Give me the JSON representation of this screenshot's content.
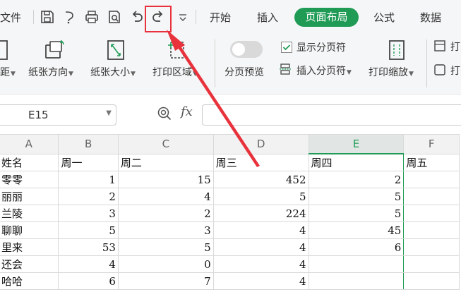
{
  "menubar": {
    "file": "文件",
    "tabs": [
      "开始",
      "插入",
      "页面布局",
      "公式",
      "数据"
    ],
    "active_tab": "页面布局",
    "quick_icons": [
      "save-icon",
      "format-painter-icon",
      "print-icon",
      "print-preview-icon",
      "undo-icon",
      "redo-icon",
      "more-dropdown-icon"
    ]
  },
  "ribbon": {
    "margins": "距",
    "orientation": "纸张方向",
    "size": "纸张大小",
    "print_area": "打印区域",
    "page_break_preview": "分页预览",
    "show_page_break": "显示分页符",
    "insert_page_break": "插入分页符",
    "print_scale": "打印缩放",
    "cut_off_1": "打",
    "cut_off_2": "打"
  },
  "formula": {
    "cell_ref": "E15",
    "fx": "fx",
    "content": ""
  },
  "sheet": {
    "columns": [
      "A",
      "B",
      "C",
      "D",
      "E",
      "F"
    ],
    "selected_column": "E",
    "rows": [
      [
        "姓名",
        "周一",
        "周二",
        "周三",
        "周四",
        "周五"
      ],
      [
        "零零",
        "1",
        "15",
        "452",
        "2",
        ""
      ],
      [
        "丽丽",
        "2",
        "4",
        "5",
        "5",
        ""
      ],
      [
        "兰陵",
        "3",
        "2",
        "224",
        "5",
        ""
      ],
      [
        "聊聊",
        "5",
        "3",
        "4",
        "45",
        ""
      ],
      [
        "里来",
        "53",
        "5",
        "4",
        "6",
        ""
      ],
      [
        "还会",
        "4",
        "0",
        "4",
        "",
        ""
      ],
      [
        "哈哈",
        "6",
        "7",
        "4",
        "",
        ""
      ]
    ]
  },
  "annotation": {
    "color": "#e8323c"
  },
  "colors": {
    "accent": "#1f9b55"
  }
}
